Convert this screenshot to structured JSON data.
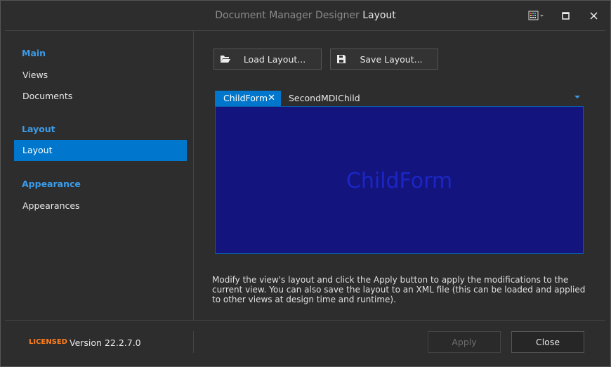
{
  "titlebar": {
    "title_main": "Document Manager Designer",
    "title_section": "Layout",
    "skin_icon": "palette-grid-icon",
    "maximize_icon": "maximize-icon",
    "close_icon": "close-icon"
  },
  "sidebar": {
    "groups": [
      {
        "label": "Main",
        "items": [
          "Views",
          "Documents"
        ]
      },
      {
        "label": "Layout",
        "items": [
          "Layout"
        ]
      },
      {
        "label": "Appearance",
        "items": [
          "Appearances"
        ]
      }
    ],
    "selected": "Layout"
  },
  "toolbar": {
    "load_label": "Load Layout...",
    "save_label": "Save Layout..."
  },
  "preview": {
    "tabs": [
      "ChildForm",
      "SecondMDIChild"
    ],
    "active_tab": "ChildForm",
    "content_label": "ChildForm"
  },
  "description": "Modify the view's layout and click the Apply button to apply the modifications to the current view. You can also save the layout to an XML file (this can be loaded and applied to other views at design time and runtime).",
  "footer": {
    "licensed": "LICENSED",
    "version": "Version 22.2.7.0",
    "apply_label": "Apply",
    "close_label": "Close"
  },
  "colors": {
    "accent": "#0077cc",
    "group_header": "#3c9be8",
    "licensed": "#ff7f1e",
    "preview_bg": "#14147e"
  }
}
